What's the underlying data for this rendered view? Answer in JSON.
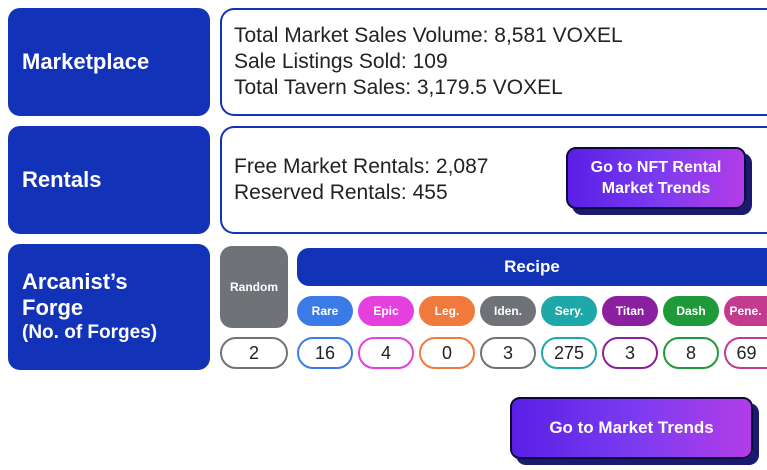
{
  "marketplace": {
    "label": "Marketplace",
    "lines": [
      "Total Market Sales Volume: 8,581 VOXEL",
      "Sale Listings Sold: 109",
      "Total Tavern Sales: 3,179.5 VOXEL"
    ]
  },
  "rentals": {
    "label": "Rentals",
    "lines": [
      "Free Market Rentals: 2,087",
      "Reserved Rentals: 455"
    ],
    "button_line1": "Go to NFT Rental",
    "button_line2": "Market Trends"
  },
  "forge": {
    "label_line1": "Arcanist’s",
    "label_line2": "Forge",
    "label_line3": "(No. of Forges)",
    "random": {
      "label": "Random",
      "value": "2",
      "color": "#6f7377"
    },
    "recipe_label": "Recipe",
    "recipes": [
      {
        "label": "Rare",
        "value": "16",
        "color": "#3b7be8"
      },
      {
        "label": "Epic",
        "value": "4",
        "color": "#e63fe0"
      },
      {
        "label": "Leg.",
        "value": "0",
        "color": "#ef7a3b"
      },
      {
        "label": "Iden.",
        "value": "3",
        "color": "#6f7377"
      },
      {
        "label": "Sery.",
        "value": "275",
        "color": "#1fa8a8"
      },
      {
        "label": "Titan",
        "value": "3",
        "color": "#8a1fa0"
      },
      {
        "label": "Dash",
        "value": "8",
        "color": "#1f9a3a"
      },
      {
        "label": "Pene.",
        "value": "69",
        "color": "#c23b8f"
      }
    ]
  },
  "footer_button": "Go to Market Trends",
  "colors": {
    "primary": "#1232b8",
    "cta_start": "#5a1fe6",
    "cta_end": "#b23de8"
  }
}
